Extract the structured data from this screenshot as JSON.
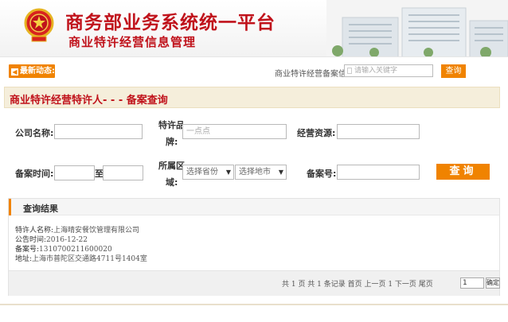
{
  "header": {
    "title": "商务部业务系统统一平台",
    "subtitle": "商业特许经营信息管理"
  },
  "topbar": {
    "news_label": "最新动态:",
    "filing_label": "商业特许经营备案信",
    "keyword_placeholder": "请输入关键字",
    "search_label": "查询"
  },
  "section": {
    "title": "商业特许经营特许人- - - 备案查询"
  },
  "form": {
    "company_label": "公司名称:",
    "brand_label_1": "特许品",
    "brand_label_2": "牌:",
    "brand_value": "一点点",
    "resource_label": "经营资源:",
    "date_label": "备案时间:",
    "date_to": "至",
    "region_label_1": "所属区",
    "region_label_2": "域:",
    "province_select": "选择省份",
    "city_select": "选择地市",
    "filing_no_label": "备案号:",
    "query_button": "查询"
  },
  "results": {
    "title": "查询结果",
    "items": [
      {
        "label": "特许人名称:",
        "value": "上海晴安餐饮管理有限公司"
      },
      {
        "label": "公告时间:",
        "value": "2016-12-22"
      },
      {
        "label": "备案号:",
        "value": "1310700211600020"
      },
      {
        "label": "地址:",
        "value": "上海市普陀区交通路4711号1404室"
      }
    ],
    "pager_text": "共 1 页 共 1 条记录 首页 上一页 1 下一页 尾页",
    "page_value": "1",
    "go_label": "确定"
  },
  "colors": {
    "brand_red": "#c0121b",
    "accent_orange": "#f08300"
  }
}
